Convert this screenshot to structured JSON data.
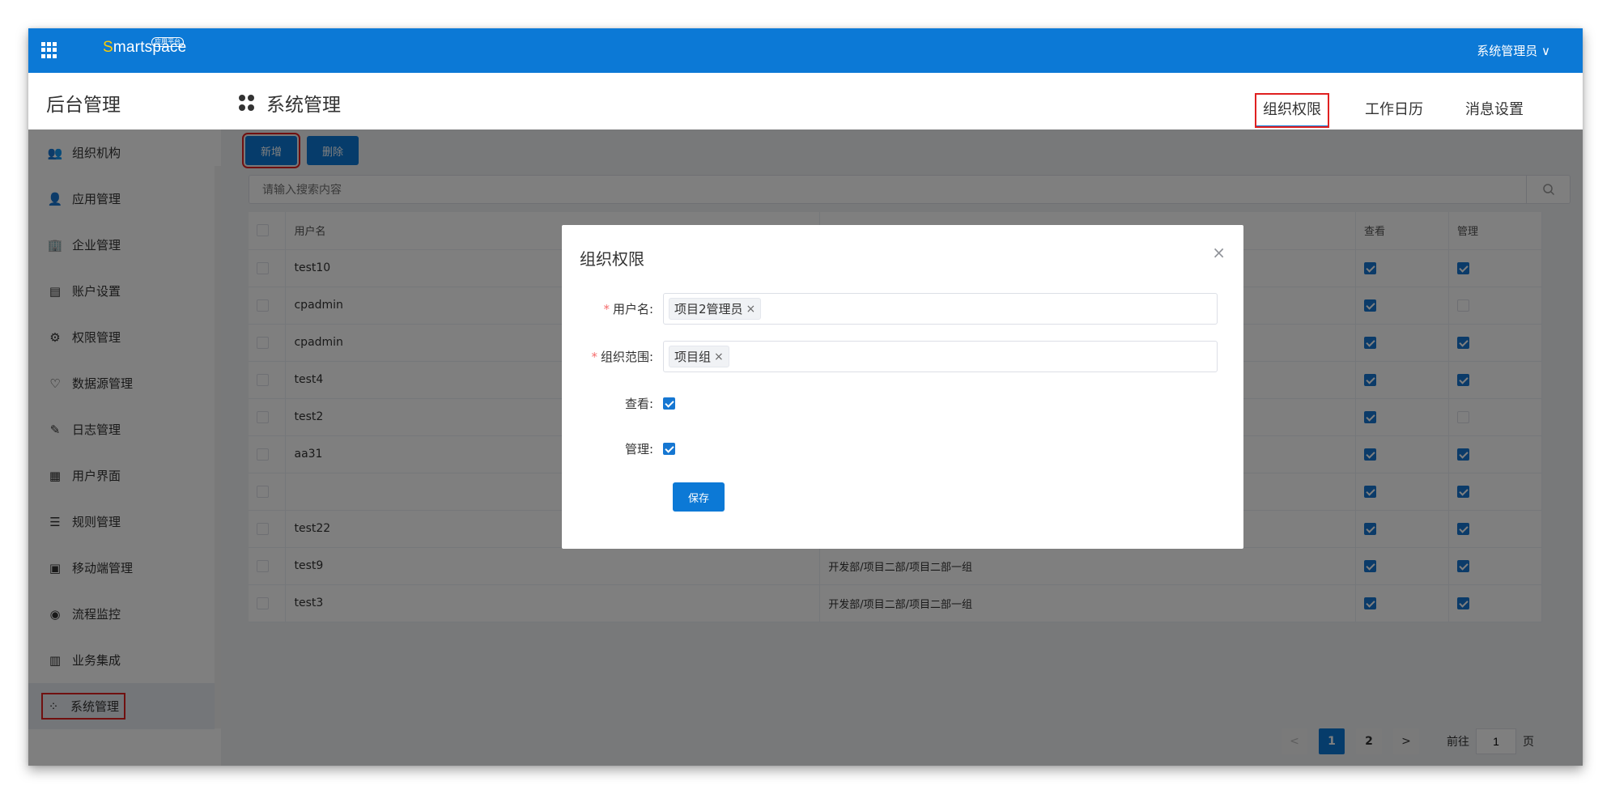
{
  "topbar": {
    "logo_text": "martspace",
    "logo_s": "S",
    "logo_badge": "应用平台",
    "user_menu": "系统管理员 ∨"
  },
  "sidebar": {
    "title": "后台管理",
    "items": [
      {
        "label": "组织机构",
        "icon": "👥"
      },
      {
        "label": "应用管理",
        "icon": "👤"
      },
      {
        "label": "企业管理",
        "icon": "🏢"
      },
      {
        "label": "账户设置",
        "icon": "▤"
      },
      {
        "label": "权限管理",
        "icon": "⚙"
      },
      {
        "label": "数据源管理",
        "icon": "♡"
      },
      {
        "label": "日志管理",
        "icon": "✎"
      },
      {
        "label": "用户界面",
        "icon": "▦"
      },
      {
        "label": "规则管理",
        "icon": "☰"
      },
      {
        "label": "移动端管理",
        "icon": "▣"
      },
      {
        "label": "流程监控",
        "icon": "◉"
      },
      {
        "label": "业务集成",
        "icon": "▥"
      },
      {
        "label": "系统管理",
        "icon": "⁘"
      }
    ]
  },
  "page": {
    "title": "系统管理",
    "tabs": [
      "组织权限",
      "工作日历",
      "消息设置"
    ]
  },
  "toolbar": {
    "add": "新增",
    "delete": "删除",
    "search_placeholder": "请输入搜索内容"
  },
  "table": {
    "headers": [
      "用户名",
      "",
      "查看",
      "管理"
    ],
    "rows": [
      {
        "user": "test10",
        "scope": "",
        "view": true,
        "manage": true
      },
      {
        "user": "cpadmin",
        "scope": "",
        "view": true,
        "manage": false
      },
      {
        "user": "cpadmin",
        "scope": "",
        "view": true,
        "manage": true
      },
      {
        "user": "test4",
        "scope": "",
        "view": true,
        "manage": true
      },
      {
        "user": "test2",
        "scope": "",
        "view": true,
        "manage": false
      },
      {
        "user": "aa31",
        "scope": "",
        "view": true,
        "manage": true
      },
      {
        "user": "",
        "scope": "",
        "view": true,
        "manage": true
      },
      {
        "user": "test22",
        "scope": "",
        "view": true,
        "manage": true
      },
      {
        "user": "test9",
        "scope": "开发部/项目二部/项目二部一组",
        "view": true,
        "manage": true
      },
      {
        "user": "test3",
        "scope": "开发部/项目二部/项目二部一组",
        "view": true,
        "manage": true
      }
    ]
  },
  "pager": {
    "pages": [
      "1",
      "2"
    ],
    "prev": "<",
    "next": ">",
    "goto_label": "前往",
    "goto_value": "1",
    "goto_suffix": "页"
  },
  "modal": {
    "title": "组织权限",
    "close": "×",
    "user_label": "用户名:",
    "user_tag": "项目2管理员",
    "scope_label": "组织范围:",
    "scope_tag": "项目组",
    "view_label": "查看:",
    "manage_label": "管理:",
    "view_checked": true,
    "manage_checked": true,
    "save": "保存"
  }
}
